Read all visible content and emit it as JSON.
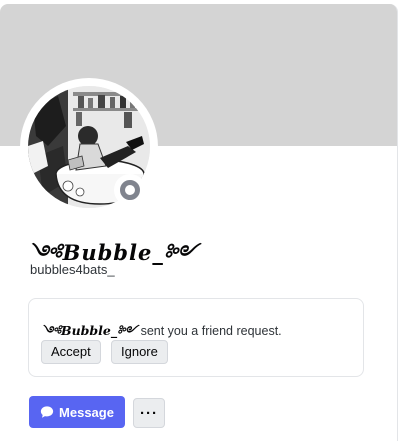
{
  "profile": {
    "display_name": "༺𝑩𝒖𝒃𝒃𝒍𝒆_༻",
    "username": "bubbles4bats_",
    "status": "offline",
    "avatar": "anime-character-avatar"
  },
  "friend_request": {
    "sender": "༺𝑩𝒖𝒃𝒃𝒍𝒆_༻",
    "text": "sent you a friend request.",
    "accept_label": "Accept",
    "ignore_label": "Ignore"
  },
  "actions": {
    "message_label": "Message",
    "message_icon": "chat-bubble-icon",
    "more_icon": "ellipsis-icon",
    "more_label": "···"
  },
  "colors": {
    "banner": "#d4d4d4",
    "accent": "#5865f2",
    "status_offline": "#80848e"
  }
}
